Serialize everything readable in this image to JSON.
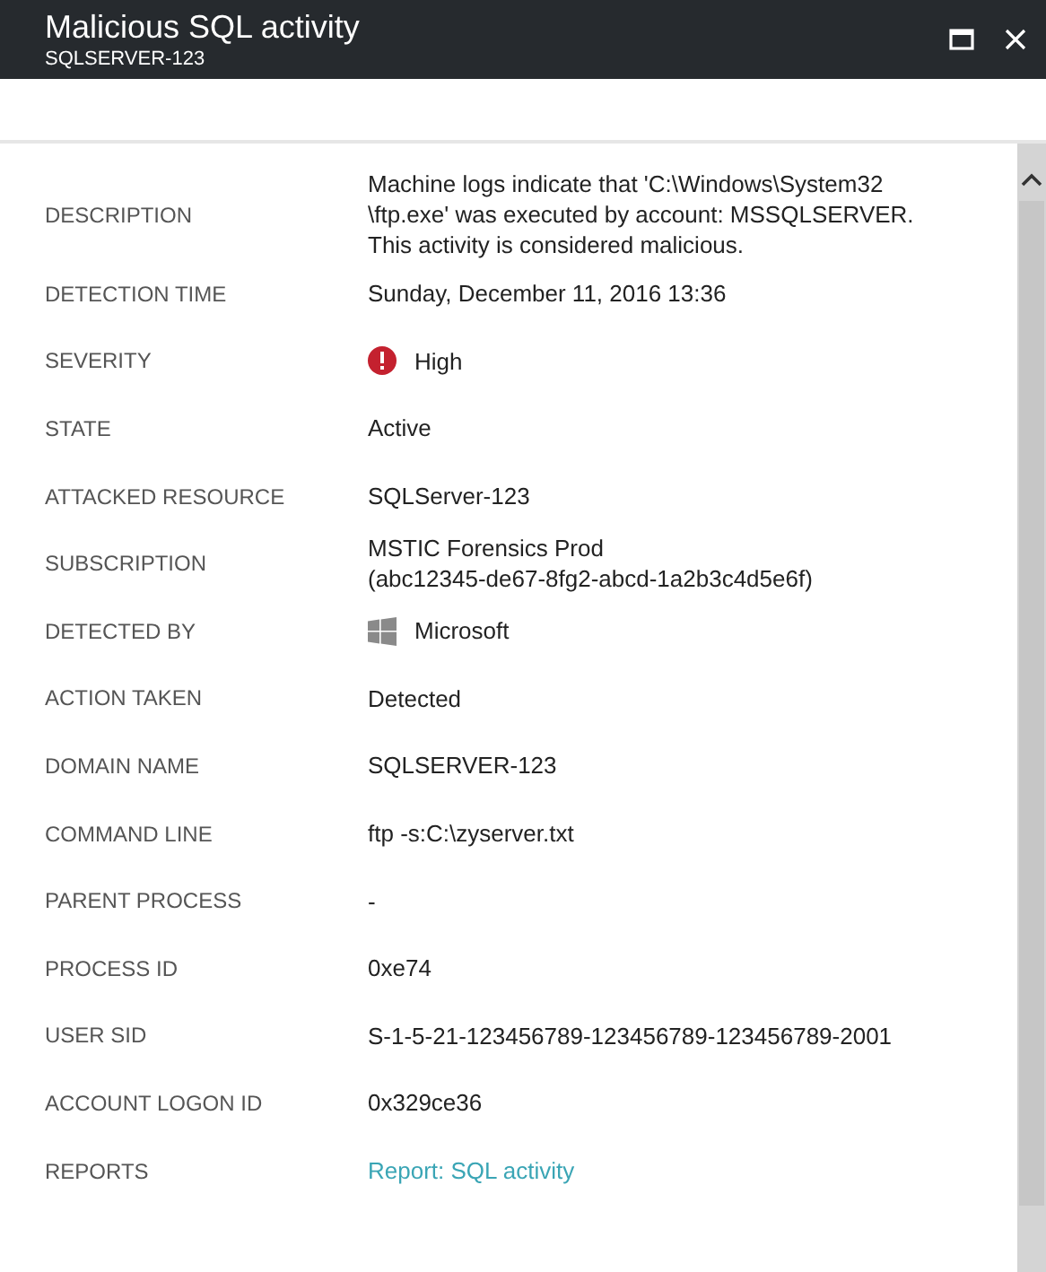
{
  "window": {
    "title": "Malicious SQL activity",
    "subtitle": "SQLSERVER-123"
  },
  "details": [
    {
      "label": "DESCRIPTION",
      "kind": "text",
      "lines": [
        "Machine logs indicate that 'C:\\Windows\\System32",
        "\\ftp.exe' was executed by account: MSSQLSERVER.",
        "This activity is considered malicious."
      ]
    },
    {
      "label": "DETECTION TIME",
      "kind": "text",
      "lines": [
        "Sunday, December 11, 2016 13:36"
      ]
    },
    {
      "label": "SEVERITY",
      "kind": "severity",
      "lines": [
        "High"
      ]
    },
    {
      "label": "STATE",
      "kind": "text",
      "lines": [
        "Active"
      ]
    },
    {
      "label": "ATTACKED RESOURCE",
      "kind": "text",
      "lines": [
        "SQLServer-123"
      ]
    },
    {
      "label": "SUBSCRIPTION",
      "kind": "text",
      "lines": [
        "MSTIC Forensics Prod",
        "(abc12345-de67-8fg2-abcd-1a2b3c4d5e6f)"
      ]
    },
    {
      "label": "DETECTED BY",
      "kind": "vendor",
      "lines": [
        "Microsoft"
      ]
    },
    {
      "label": "ACTION TAKEN",
      "kind": "text",
      "lines": [
        "Detected"
      ]
    },
    {
      "label": "DOMAIN NAME",
      "kind": "text",
      "lines": [
        "SQLSERVER-123"
      ]
    },
    {
      "label": "COMMAND LINE",
      "kind": "text",
      "lines": [
        "ftp -s:C:\\zyserver.txt"
      ]
    },
    {
      "label": "PARENT PROCESS",
      "kind": "text",
      "lines": [
        "-"
      ]
    },
    {
      "label": "PROCESS ID",
      "kind": "text",
      "lines": [
        "0xe74"
      ]
    },
    {
      "label": "USER SID",
      "kind": "text",
      "lines": [
        "S-1-5-21-123456789-123456789-123456789-2001"
      ]
    },
    {
      "label": "ACCOUNT LOGON ID",
      "kind": "text",
      "lines": [
        "0x329ce36"
      ]
    },
    {
      "label": "REPORTS",
      "kind": "link",
      "lines": [
        "Report: SQL activity"
      ]
    }
  ]
}
